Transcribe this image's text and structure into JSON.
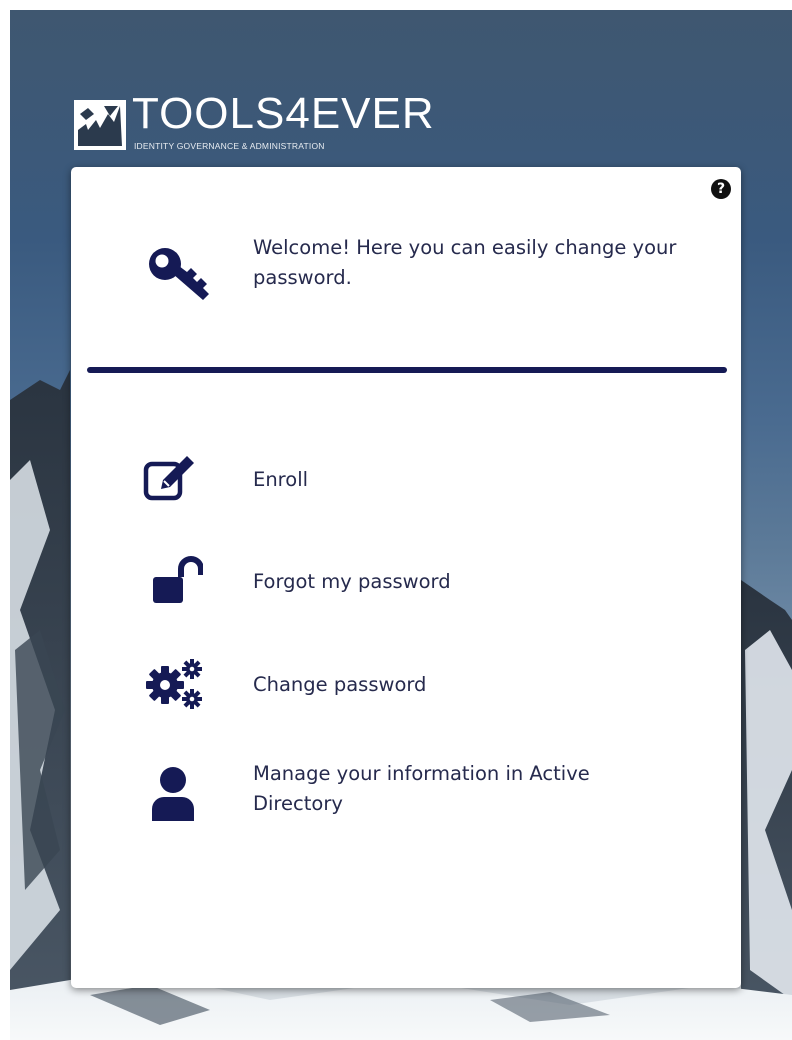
{
  "brand": {
    "name": "TOOLS4EVER",
    "tagline": "IDENTITY GOVERNANCE & ADMINISTRATION",
    "logo_icon": "tools4ever-mark-icon"
  },
  "card": {
    "help_icon": "question-circle-icon",
    "help_glyph": "?",
    "welcome_icon": "key-icon",
    "welcome_text": "Welcome! Here you can easily change your password."
  },
  "menu": {
    "items": [
      {
        "label": "Enroll",
        "icon": "edit-square-icon"
      },
      {
        "label": "Forgot my password",
        "icon": "unlock-icon"
      },
      {
        "label": "Change password",
        "icon": "cogs-icon"
      },
      {
        "label": "Manage your information in Active Directory",
        "icon": "user-icon"
      }
    ]
  },
  "colors": {
    "accent": "#151a55",
    "text": "#262a4d",
    "card_bg": "#ffffff"
  }
}
